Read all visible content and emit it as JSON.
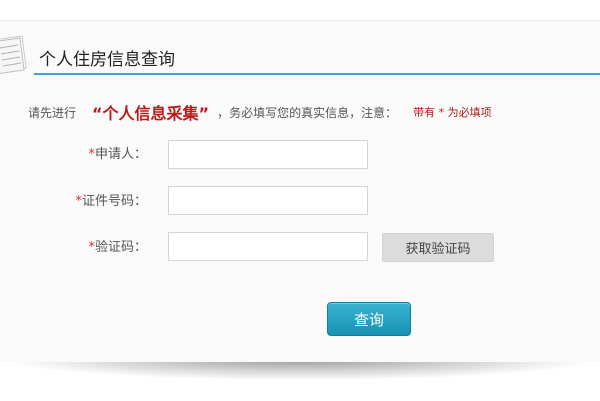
{
  "header": {
    "title": "个人住房信息查询"
  },
  "notice": {
    "prefix": "请先进行",
    "highlight": "“个人信息采集”",
    "middle": "，务必填写您的真实信息，注意：",
    "required_note": "带有 * 为必填项"
  },
  "form": {
    "required_mark": "*",
    "applicant": {
      "label": "申请人：",
      "value": ""
    },
    "id_number": {
      "label": "证件号码：",
      "value": ""
    },
    "captcha": {
      "label": "验证码：",
      "value": ""
    }
  },
  "buttons": {
    "get_code": "获取验证码",
    "query": "查询"
  },
  "icons": {
    "header": "document-icon"
  },
  "colors": {
    "accent": "#3aa8c8",
    "button": "#1a9ab9",
    "highlight": "#b51c1c",
    "required": "#d0342c"
  }
}
